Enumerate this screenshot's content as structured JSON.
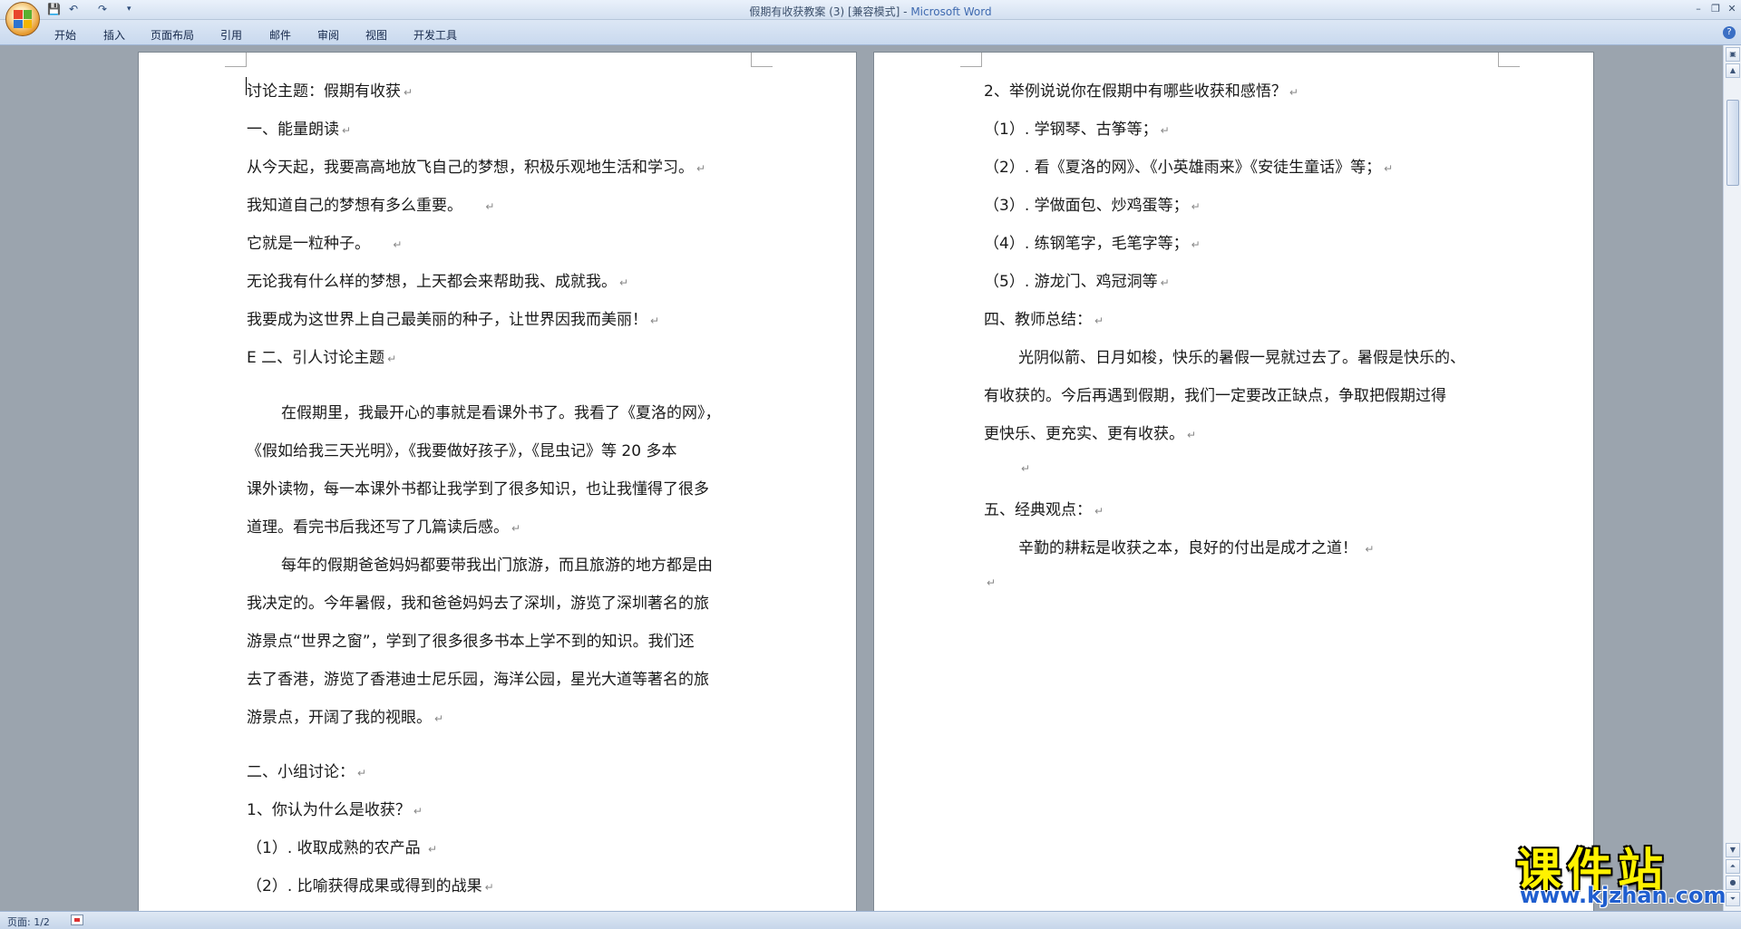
{
  "window": {
    "title_doc": "假期有收获教案 (3) [兼容模式] - ",
    "title_app": "Microsoft Word",
    "quick_access": {
      "save": "💾",
      "undo": "↶",
      "redo": "↷",
      "customize": "▾"
    },
    "controls": {
      "minimize": "–",
      "restore": "❐",
      "close": "✕"
    }
  },
  "ribbon": {
    "tabs": [
      "开始",
      "插入",
      "页面布局",
      "引用",
      "邮件",
      "审阅",
      "视图",
      "开发工具"
    ],
    "help": "?"
  },
  "document": {
    "left_page": [
      "讨论主题：假期有收获",
      "一、能量朗读",
      "从今天起，我要高高地放飞自己的梦想，积极乐观地生活和学习。",
      "我知道自己的梦想有多么重要。 ",
      "它就是一粒种子。 ",
      "无论我有什么样的梦想，上天都会来帮助我、成就我。",
      "我要成为这世界上自己最美丽的种子，让世界因我而美丽！",
      "E 二、引人讨论主题",
      "在假期里，我最开心的事就是看课外书了。我看了《夏洛的网》，",
      "《假如给我三天光明》，《我要做好孩子》，《昆虫记》等 20 多本",
      "课外读物，每一本课外书都让我学到了很多知识，也让我懂得了很多",
      "道理。看完书后我还写了几篇读后感。",
      "每年的假期爸爸妈妈都要带我出门旅游，而且旅游的地方都是由",
      "我决定的。今年暑假，我和爸爸妈妈去了深圳，游览了深圳著名的旅",
      "游景点“世界之窗”，学到了很多很多书本上学不到的知识。我们还",
      "去了香港，游览了香港迪士尼乐园，海洋公园，星光大道等著名的旅",
      "游景点，开阔了我的视眼。",
      "二、小组讨论：",
      "1、你认为什么是收获？",
      "（1）. 收取成熟的农产品 ",
      "（2）. 比喻获得成果或得到的战果"
    ],
    "right_page": [
      "2、举例说说你在假期中有哪些收获和感悟？",
      "（1）. 学钢琴、古筝等；",
      "（2）. 看《夏洛的网》、《小英雄雨来》《安徒生童话》等；",
      "（3）. 学做面包、炒鸡蛋等；",
      "（4）. 练钢笔字，毛笔字等；",
      "（5）. 游龙门、鸡冠洞等",
      "四、教师总结：",
      "光阴似箭、日月如梭，快乐的暑假一晃就过去了。暑假是快乐的、",
      "有收获的。今后再遇到假期，我们一定要改正缺点，争取把假期过得",
      "更快乐、更充实、更有收获。",
      "",
      "五、经典观点：",
      "辛勤的耕耘是收获之本，良好的付出是成才之道！ ",
      ""
    ],
    "paragraph_mark": "↵"
  },
  "status": {
    "page": "页面: 1/2"
  },
  "watermark": {
    "main": "课件站",
    "url": "www.kjzhan.com"
  }
}
